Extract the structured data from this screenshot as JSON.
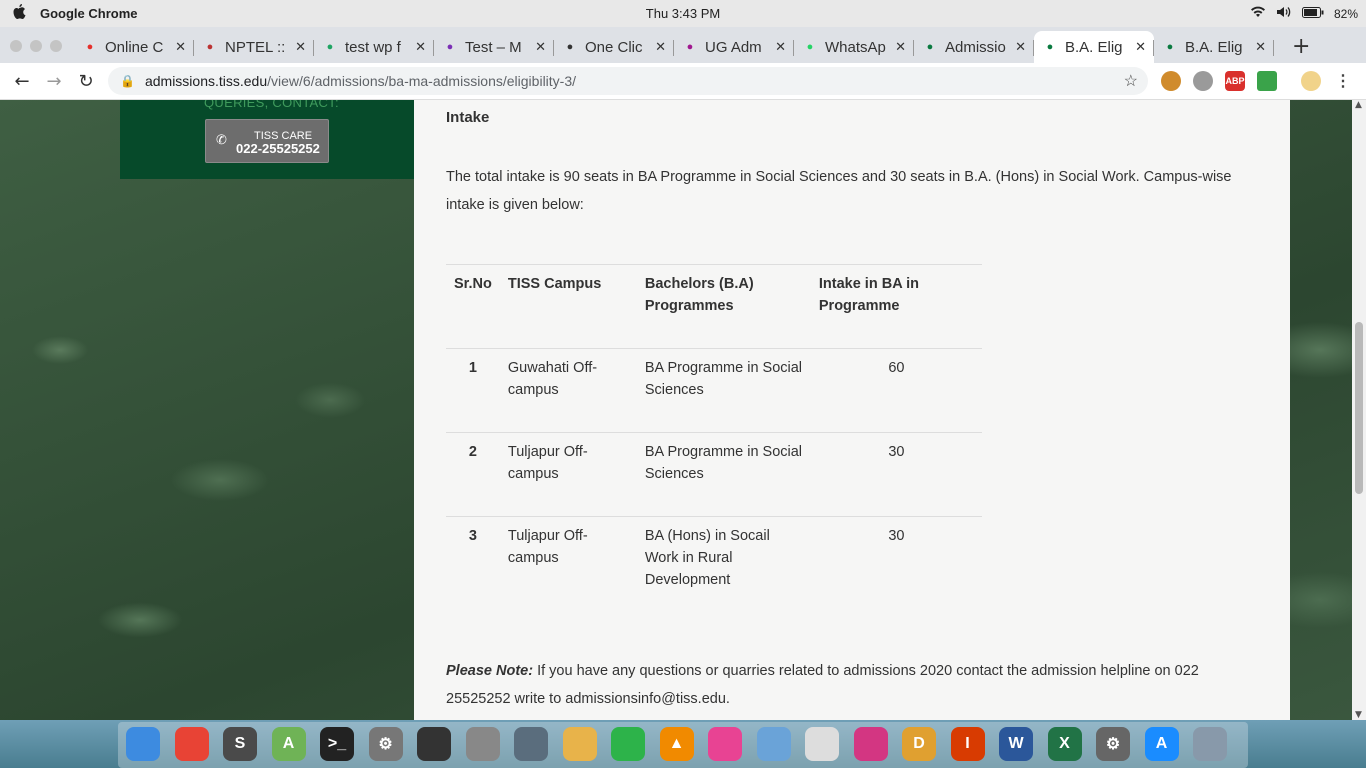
{
  "menubar": {
    "app_name": "Google Chrome",
    "clock": "Thu  3:43 PM",
    "battery": "82%"
  },
  "tabs": [
    {
      "title": "Online C",
      "icon": "udemy-icon",
      "color": "#e5302c"
    },
    {
      "title": "NPTEL ::",
      "icon": "nptel-icon",
      "color": "#b33"
    },
    {
      "title": "test wp f",
      "icon": "drive-icon",
      "color": "#1fa463"
    },
    {
      "title": "Test – M",
      "icon": "en-icon",
      "color": "#7b2fb5"
    },
    {
      "title": "One Clic",
      "icon": "globe-icon",
      "color": "#333"
    },
    {
      "title": "UG Adm",
      "icon": "ug-icon",
      "color": "#a0188f"
    },
    {
      "title": "WhatsAp",
      "icon": "whatsapp-icon",
      "color": "#25d366"
    },
    {
      "title": "Admissio",
      "icon": "tiss-icon",
      "color": "#0a7a40"
    },
    {
      "title": "B.A. Elig",
      "icon": "tiss-icon",
      "color": "#0a7a40",
      "active": true
    },
    {
      "title": "B.A. Elig",
      "icon": "tiss-icon",
      "color": "#0a7a40"
    }
  ],
  "url": {
    "host": "admissions.tiss.edu",
    "path": "/view/6/admissions/ba-ma-admissions/eligibility-3/"
  },
  "extensions": {
    "abp": "ABP"
  },
  "sidebar": {
    "queries_label": "QUERIES, CONTACT:",
    "care_label": "TISS CARE",
    "care_phone": "022-25525252"
  },
  "content": {
    "heading": "Intake",
    "paragraph": "The total intake is 90 seats in BA Programme in Social Sciences and 30 seats in B.A. (Hons) in Social Work. Campus-wise intake is given below:",
    "table": {
      "headers": [
        "Sr.No",
        "TISS Campus",
        "Bachelors (B.A) Programmes",
        "Intake in BA in  Programme"
      ],
      "rows": [
        {
          "sr": "1",
          "campus": "Guwahati Off-campus",
          "programme": "BA Programme in Social Sciences",
          "intake": "60"
        },
        {
          "sr": "2",
          "campus": "Tuljapur Off-campus",
          "programme": "BA Programme in Social Sciences",
          "intake": "30"
        },
        {
          "sr": "3",
          "campus": "Tuljapur Off-campus",
          "programme": "BA (Hons) in Socail Work in Rural Development",
          "intake": "30"
        }
      ]
    },
    "note_label": "Please Note:",
    "note_text": " If you have any questions or quarries related to admissions 2020 contact the admission helpline on 022 25525252 write to admissionsinfo@tiss.edu."
  },
  "dock": [
    {
      "name": "finder-icon",
      "label": "",
      "color": "#3d8be0"
    },
    {
      "name": "chrome-icon",
      "label": "",
      "color": "#e84335"
    },
    {
      "name": "sublime-icon",
      "label": "S",
      "color": "#4a4a4a"
    },
    {
      "name": "android-studio-icon",
      "label": "A",
      "color": "#6fb356"
    },
    {
      "name": "terminal-icon",
      "label": ">_",
      "color": "#222"
    },
    {
      "name": "system-prefs-icon",
      "label": "⚙",
      "color": "#777"
    },
    {
      "name": "activity-monitor-icon",
      "label": "",
      "color": "#333"
    },
    {
      "name": "calculator-icon",
      "label": "",
      "color": "#888"
    },
    {
      "name": "disk-utility-icon",
      "label": "",
      "color": "#5a6d7d"
    },
    {
      "name": "notes-icon",
      "label": "",
      "color": "#e8b34a"
    },
    {
      "name": "facetime-icon",
      "label": "",
      "color": "#2db34a"
    },
    {
      "name": "vlc-icon",
      "label": "▲",
      "color": "#f18a00"
    },
    {
      "name": "photos-icon",
      "label": "",
      "color": "#e84393"
    },
    {
      "name": "preview-icon",
      "label": "",
      "color": "#6aa3d8"
    },
    {
      "name": "calendar-icon",
      "label": "",
      "color": "#ddd"
    },
    {
      "name": "onenote-icon",
      "label": "",
      "color": "#d33682"
    },
    {
      "name": "d-app-icon",
      "label": "D",
      "color": "#e0a030"
    },
    {
      "name": "office-icon",
      "label": "I",
      "color": "#d83b01"
    },
    {
      "name": "word-icon",
      "label": "W",
      "color": "#2b579a"
    },
    {
      "name": "excel-icon",
      "label": "X",
      "color": "#217346"
    },
    {
      "name": "settings-icon",
      "label": "⚙",
      "color": "#666"
    },
    {
      "name": "app-store-icon",
      "label": "A",
      "color": "#1a8cff"
    },
    {
      "name": "launchpad-icon",
      "label": "",
      "color": "#8899aa"
    }
  ]
}
